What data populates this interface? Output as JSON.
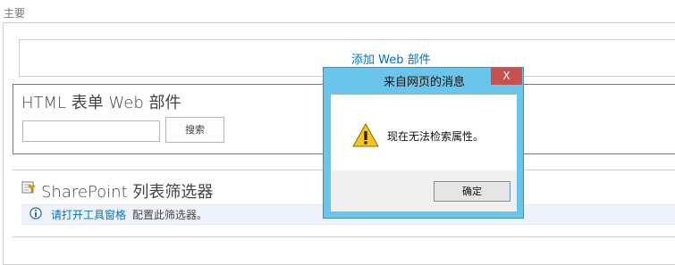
{
  "zone": {
    "label": "主要"
  },
  "add_zone": {
    "link": "添加 Web 部件"
  },
  "html_form_part": {
    "title": "HTML 表单 Web 部件",
    "search_input_value": "",
    "search_button": "搜索"
  },
  "filter_part": {
    "title": "SharePoint 列表筛选器",
    "info_link": "请打开工具窗格",
    "info_rest": "配置此筛选器。"
  },
  "dialog": {
    "title": "来自网页的消息",
    "close_label": "X",
    "message": "现在无法检索属性。",
    "ok_button": "确定"
  },
  "colors": {
    "accent": "#0072c6",
    "dialog_frame": "#6bc5ea",
    "close": "#c75050"
  }
}
